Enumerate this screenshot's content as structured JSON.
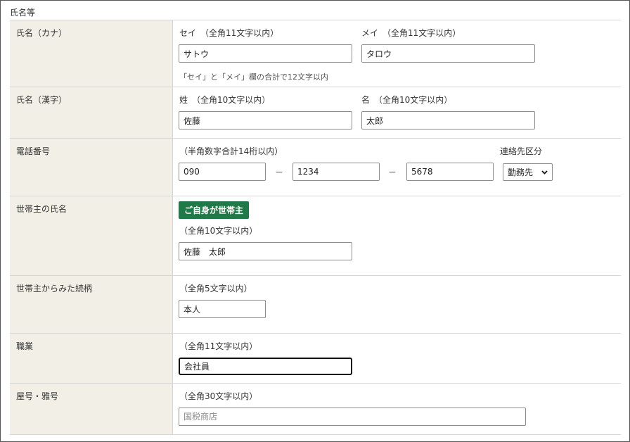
{
  "section": {
    "title": "氏名等"
  },
  "rows": {
    "kana": {
      "label": "氏名（カナ）",
      "sei_caption": "セイ　（全角11文字以内）",
      "mei_caption": "メイ　（全角11文字以内）",
      "sei_value": "サトウ",
      "mei_value": "タロウ",
      "note": "「セイ」と「メイ」欄の合計で12文字以内"
    },
    "kanji": {
      "label": "氏名（漢字）",
      "sei_caption": "姓　（全角10文字以内）",
      "mei_caption": "名　（全角10文字以内）",
      "sei_value": "佐藤",
      "mei_value": "太郎"
    },
    "phone": {
      "label": "電話番号",
      "caption": "（半角数字合計14桁以内）",
      "part1": "090",
      "part2": "1234",
      "part3": "5678",
      "separator": "－",
      "contact_caption": "連絡先区分",
      "contact_selected": "勤務先"
    },
    "householder": {
      "label": "世帯主の氏名",
      "button_label": "ご自身が世帯主",
      "caption": "（全角10文字以内）",
      "value": "佐藤　太郎"
    },
    "relation": {
      "label": "世帯主からみた続柄",
      "caption": "（全角5文字以内）",
      "value": "本人"
    },
    "occupation": {
      "label": "職業",
      "caption": "（全角11文字以内）",
      "value": "会社員"
    },
    "trade_name": {
      "label": "屋号・雅号",
      "caption": "（全角30文字以内）",
      "placeholder": "国税商店"
    }
  },
  "colors": {
    "label_background": "#f2f0e6",
    "button_green": "#1f7a47",
    "border": "#d6d6d6"
  },
  "icons": {
    "select_arrow": "chevron-down-icon"
  }
}
